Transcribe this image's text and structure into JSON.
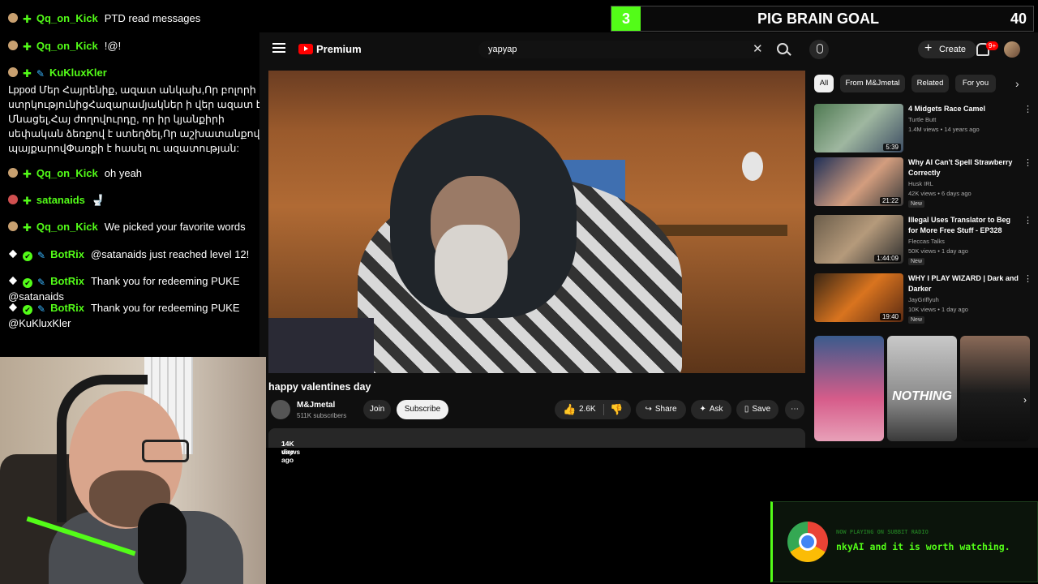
{
  "chat": {
    "messages": [
      {
        "user": "Qq_on_Kick",
        "text": "PTD read messages"
      },
      {
        "user": "Qq_on_Kick",
        "text": "!@!"
      },
      {
        "user": "KuKluxKler",
        "text": "Լppod Մեր Հայրենիք, ազատ անկախ,Որ բոլորի ստրկությունիցՀազարամյակներ ի վեր ազատ է Մնացել,Հայ ժողովուրդը, որ իր կյանքիրի սեփական ձեռքով է ստեղծել,Որ աշխատանքով ու պայքարովՓառքի է հասել ու ազատության:"
      },
      {
        "user": "Qq_on_Kick",
        "text": "oh yeah"
      },
      {
        "user": "satanaids",
        "text": "🚽"
      },
      {
        "user": "Qq_on_Kick",
        "text": "We picked your favorite words"
      },
      {
        "user": "BotRix",
        "text": "@satanaids just reached level 12!"
      },
      {
        "user": "BotRix",
        "text": "Thank you for redeeming PUKE @satanaids"
      },
      {
        "user": "BotRix",
        "text": "Thank you for redeeming PUKE @KuKluxKler"
      }
    ]
  },
  "goal": {
    "level": "3",
    "title": "PIG BRAIN GOAL",
    "count": "40"
  },
  "youtube": {
    "brand": "Premium",
    "search": {
      "value": "yapyap"
    },
    "create_label": "Create",
    "notification_count": "9+",
    "video": {
      "title": "happy valentines day",
      "channel": "M&Jmetal",
      "subscribers": "511K subscribers",
      "join_label": "Join",
      "subscribe_label": "Subscribe",
      "likes": "2.6K",
      "share_label": "Share",
      "ask_label": "Ask",
      "save_label": "Save",
      "views": "14K views",
      "posted": "1 day ago"
    },
    "chips": [
      "All",
      "From M&Jmetal",
      "Related",
      "For you"
    ],
    "recommendations": [
      {
        "title": "4 Midgets Race Camel",
        "channel": "Turtle Butt",
        "meta": "1.4M views • 14 years ago",
        "duration": "5:39",
        "new": ""
      },
      {
        "title": "Why AI Can't Spell Strawberry Correctly",
        "channel": "Husk IRL",
        "meta": "42K views • 6 days ago",
        "duration": "21:22",
        "new": "New"
      },
      {
        "title": "Illegal Uses Translator to Beg for More Free Stuff - EP328",
        "channel": "Fleccas Talks",
        "meta": "50K views • 1 day ago",
        "duration": "1:44:09",
        "new": "New"
      },
      {
        "title": "WHY I PLAY WIZARD | Dark and Darker",
        "channel": "JayGriffyuh",
        "meta": "10K views • 1 day ago",
        "duration": "19:40",
        "new": "New"
      }
    ],
    "shorts": [
      {
        "caption": ""
      },
      {
        "caption": "NOTHING"
      },
      {
        "caption": ""
      }
    ]
  },
  "now_playing": {
    "label": "NOW PLAYING ON SUBBIT RADIO",
    "text": "nkyAI and it is worth watching."
  },
  "colors": {
    "kick_green": "#53fc18",
    "youtube_red": "#ff0000",
    "bg": "#0f0f0f"
  }
}
